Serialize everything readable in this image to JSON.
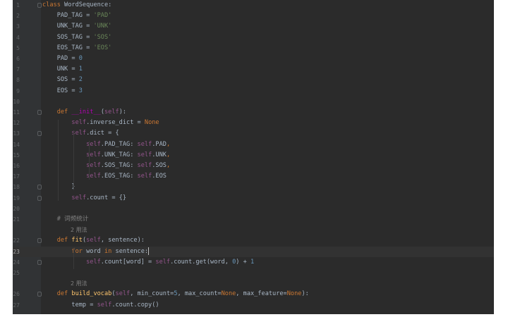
{
  "editor": {
    "lines": [
      {
        "number": "1",
        "fold": true,
        "tokens": [
          {
            "t": "class ",
            "c": "kw"
          },
          {
            "t": "WordSequence:",
            "c": "plain"
          }
        ]
      },
      {
        "number": "2",
        "tokens": [
          {
            "t": "    PAD_TAG = ",
            "c": "plain"
          },
          {
            "t": "'PAD'",
            "c": "str"
          }
        ]
      },
      {
        "number": "3",
        "tokens": [
          {
            "t": "    UNK_TAG = ",
            "c": "plain"
          },
          {
            "t": "'UNK'",
            "c": "str"
          }
        ]
      },
      {
        "number": "4",
        "tokens": [
          {
            "t": "    SOS_TAG = ",
            "c": "plain"
          },
          {
            "t": "'SOS'",
            "c": "str"
          }
        ]
      },
      {
        "number": "5",
        "tokens": [
          {
            "t": "    EOS_TAG = ",
            "c": "plain"
          },
          {
            "t": "'EOS'",
            "c": "str"
          }
        ]
      },
      {
        "number": "6",
        "tokens": [
          {
            "t": "    PAD = ",
            "c": "plain"
          },
          {
            "t": "0",
            "c": "num"
          }
        ]
      },
      {
        "number": "7",
        "tokens": [
          {
            "t": "    UNK = ",
            "c": "plain"
          },
          {
            "t": "1",
            "c": "num"
          }
        ]
      },
      {
        "number": "8",
        "tokens": [
          {
            "t": "    SOS = ",
            "c": "plain"
          },
          {
            "t": "2",
            "c": "num"
          }
        ]
      },
      {
        "number": "9",
        "tokens": [
          {
            "t": "    EOS = ",
            "c": "plain"
          },
          {
            "t": "3",
            "c": "num"
          }
        ]
      },
      {
        "number": "10",
        "tokens": []
      },
      {
        "number": "11",
        "fold": true,
        "tokens": [
          {
            "t": "    ",
            "c": "plain"
          },
          {
            "t": "def ",
            "c": "kw"
          },
          {
            "t": "__init__",
            "c": "magic"
          },
          {
            "t": "(",
            "c": "plain"
          },
          {
            "t": "self",
            "c": "self"
          },
          {
            "t": "):",
            "c": "plain"
          }
        ]
      },
      {
        "number": "12",
        "tokens": [
          {
            "t": "        ",
            "c": "plain"
          },
          {
            "t": "self",
            "c": "self"
          },
          {
            "t": ".inverse_dict = ",
            "c": "plain"
          },
          {
            "t": "None",
            "c": "kw"
          }
        ]
      },
      {
        "number": "13",
        "fold": true,
        "tokens": [
          {
            "t": "        ",
            "c": "plain"
          },
          {
            "t": "self",
            "c": "self"
          },
          {
            "t": ".dict = {",
            "c": "plain"
          }
        ]
      },
      {
        "number": "14",
        "tokens": [
          {
            "t": "            ",
            "c": "plain"
          },
          {
            "t": "self",
            "c": "self"
          },
          {
            "t": ".PAD_TAG: ",
            "c": "plain"
          },
          {
            "t": "self",
            "c": "self"
          },
          {
            "t": ".PAD",
            "c": "plain"
          },
          {
            "t": ",",
            "c": "kw"
          }
        ]
      },
      {
        "number": "15",
        "tokens": [
          {
            "t": "            ",
            "c": "plain"
          },
          {
            "t": "self",
            "c": "self"
          },
          {
            "t": ".UNK_TAG: ",
            "c": "plain"
          },
          {
            "t": "self",
            "c": "self"
          },
          {
            "t": ".UNK",
            "c": "plain"
          },
          {
            "t": ",",
            "c": "kw"
          }
        ]
      },
      {
        "number": "16",
        "tokens": [
          {
            "t": "            ",
            "c": "plain"
          },
          {
            "t": "self",
            "c": "self"
          },
          {
            "t": ".SOS_TAG: ",
            "c": "plain"
          },
          {
            "t": "self",
            "c": "self"
          },
          {
            "t": ".SOS",
            "c": "plain"
          },
          {
            "t": ",",
            "c": "kw"
          }
        ]
      },
      {
        "number": "17",
        "tokens": [
          {
            "t": "            ",
            "c": "plain"
          },
          {
            "t": "self",
            "c": "self"
          },
          {
            "t": ".EOS_TAG: ",
            "c": "plain"
          },
          {
            "t": "self",
            "c": "self"
          },
          {
            "t": ".EOS",
            "c": "plain"
          }
        ]
      },
      {
        "number": "18",
        "fold": true,
        "tokens": [
          {
            "t": "        }",
            "c": "plain"
          }
        ]
      },
      {
        "number": "19",
        "fold": true,
        "tokens": [
          {
            "t": "        ",
            "c": "plain"
          },
          {
            "t": "self",
            "c": "self"
          },
          {
            "t": ".count = {}",
            "c": "plain"
          }
        ]
      },
      {
        "number": "20",
        "tokens": []
      },
      {
        "number": "21",
        "tokens": [
          {
            "t": "    # 词频统计",
            "c": "cmt"
          }
        ]
      },
      {
        "annotation": "2 用法"
      },
      {
        "number": "22",
        "fold": true,
        "tokens": [
          {
            "t": "    ",
            "c": "plain"
          },
          {
            "t": "def ",
            "c": "kw"
          },
          {
            "t": "fit",
            "c": "fn"
          },
          {
            "t": "(",
            "c": "plain"
          },
          {
            "t": "self",
            "c": "self"
          },
          {
            "t": ", sentence):",
            "c": "plain"
          }
        ]
      },
      {
        "number": "23",
        "current": true,
        "tokens": [
          {
            "t": "        ",
            "c": "plain"
          },
          {
            "t": "for ",
            "c": "kw"
          },
          {
            "t": "word ",
            "c": "plain"
          },
          {
            "t": "in ",
            "c": "kw"
          },
          {
            "t": "sentence:",
            "c": "plain"
          }
        ]
      },
      {
        "number": "24",
        "fold": true,
        "tokens": [
          {
            "t": "            ",
            "c": "plain"
          },
          {
            "t": "self",
            "c": "self"
          },
          {
            "t": ".count[word] = ",
            "c": "plain"
          },
          {
            "t": "self",
            "c": "self"
          },
          {
            "t": ".count.get(word, ",
            "c": "plain"
          },
          {
            "t": "0",
            "c": "num"
          },
          {
            "t": ") + ",
            "c": "plain"
          },
          {
            "t": "1",
            "c": "num"
          }
        ]
      },
      {
        "number": "25",
        "tokens": []
      },
      {
        "annotation": "2 用法"
      },
      {
        "number": "26",
        "fold": true,
        "tokens": [
          {
            "t": "    ",
            "c": "plain"
          },
          {
            "t": "def ",
            "c": "kw"
          },
          {
            "t": "build_vocab",
            "c": "fn"
          },
          {
            "t": "(",
            "c": "plain"
          },
          {
            "t": "self",
            "c": "self"
          },
          {
            "t": ", min_count=",
            "c": "plain"
          },
          {
            "t": "5",
            "c": "num"
          },
          {
            "t": ", max_count=",
            "c": "plain"
          },
          {
            "t": "None",
            "c": "kw"
          },
          {
            "t": ", max_feature=",
            "c": "plain"
          },
          {
            "t": "None",
            "c": "kw"
          },
          {
            "t": "):",
            "c": "plain"
          }
        ]
      },
      {
        "number": "27",
        "tokens": [
          {
            "t": "        temp = ",
            "c": "plain"
          },
          {
            "t": "self",
            "c": "self"
          },
          {
            "t": ".count.copy()",
            "c": "plain"
          }
        ]
      }
    ]
  }
}
